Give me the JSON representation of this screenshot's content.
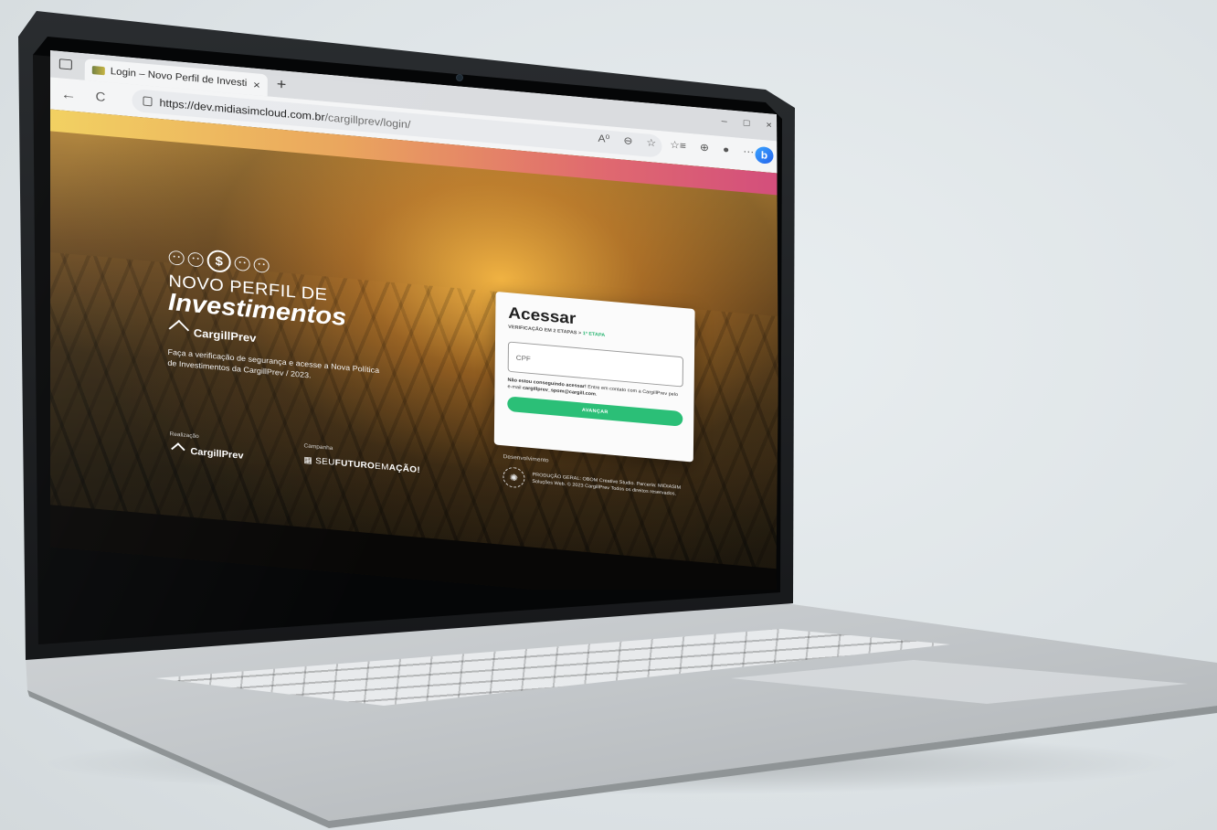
{
  "browser": {
    "tab_title": "Login – Novo Perfil de Investime",
    "tab_close": "×",
    "new_tab": "+",
    "back_icon": "←",
    "reload_icon": "C",
    "url_host": "https://dev.midiasimcloud.com.br",
    "url_path": "/cargillprev/login/",
    "toolbar_icons": [
      "A⁰",
      "⊖",
      "☆",
      "☆≡",
      "⊕",
      "●",
      "···"
    ],
    "window_controls": [
      "–",
      "□",
      "×"
    ],
    "bing_label": "b"
  },
  "hero": {
    "dollar": "$",
    "line1": "NOVO PERFIL DE",
    "line2": "Investimentos",
    "brand": "CargillPrev",
    "description": "Faça a verificação de segurança e acesse a Nova Política de Investimentos da CargillPrev / 2023."
  },
  "login": {
    "title": "Acessar",
    "subtitle": "VERIFICAÇÃO EM 2 ETAPAS >",
    "step": "1ª ETAPA",
    "cpf_placeholder": "CPF",
    "help_bold": "Não estou conseguindo acessar!",
    "help_text": " Entre em contato com a CargillPrev pelo e-mail ",
    "help_email": "cargillprev_spom@cargill.com",
    "help_end": ".",
    "button": "AVANÇAR"
  },
  "footer": {
    "realizacao_label": "Realização",
    "realizacao_brand": "CargillPrev",
    "campanha_label": "Campanha",
    "campanha_prefix": "SEU",
    "campanha_bold1": "FUTURO",
    "campanha_mid": "EM",
    "campanha_bold2": "AÇÃO!",
    "dev_label": "Desenvolvimento",
    "dev_text": "PRODUÇÃO GERAL: OBOM Creative Studio. Parceria: MIDIASIM Soluções Web. © 2023 CargillPrev Todos os direitos reservados."
  }
}
